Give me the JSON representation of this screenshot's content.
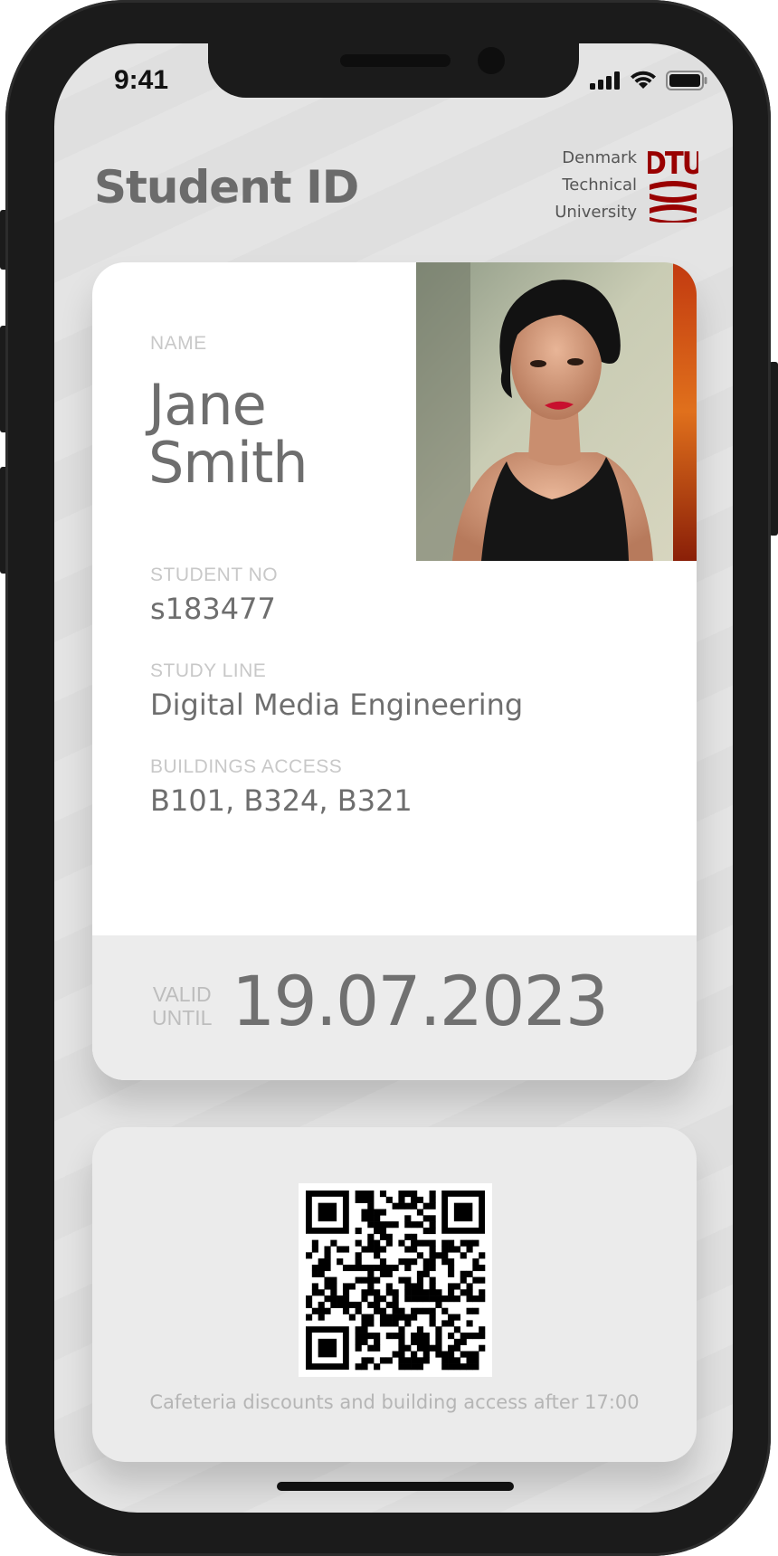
{
  "status_bar": {
    "time": "9:41",
    "icons": [
      "signal-icon",
      "wifi-icon",
      "battery-icon"
    ]
  },
  "header": {
    "title": "Student ID",
    "university": {
      "line1": "Denmark",
      "line2": "Technical",
      "line3": "University",
      "logo_text": "DTU",
      "logo_color": "#990000"
    }
  },
  "card": {
    "name_label": "NAME",
    "first_name": "Jane",
    "last_name": "Smith",
    "student_no_label": "STUDENT NO",
    "student_no": "s183477",
    "study_line_label": "STUDY LINE",
    "study_line": "Digital Media Engineering",
    "buildings_label": "BUILDINGS ACCESS",
    "buildings": "B101, B324, B321",
    "valid_label_1": "VALID",
    "valid_label_2": "UNTIL",
    "valid_until": "19.07.2023"
  },
  "qr": {
    "caption": "Cafeteria discounts and building access after 17:00"
  }
}
